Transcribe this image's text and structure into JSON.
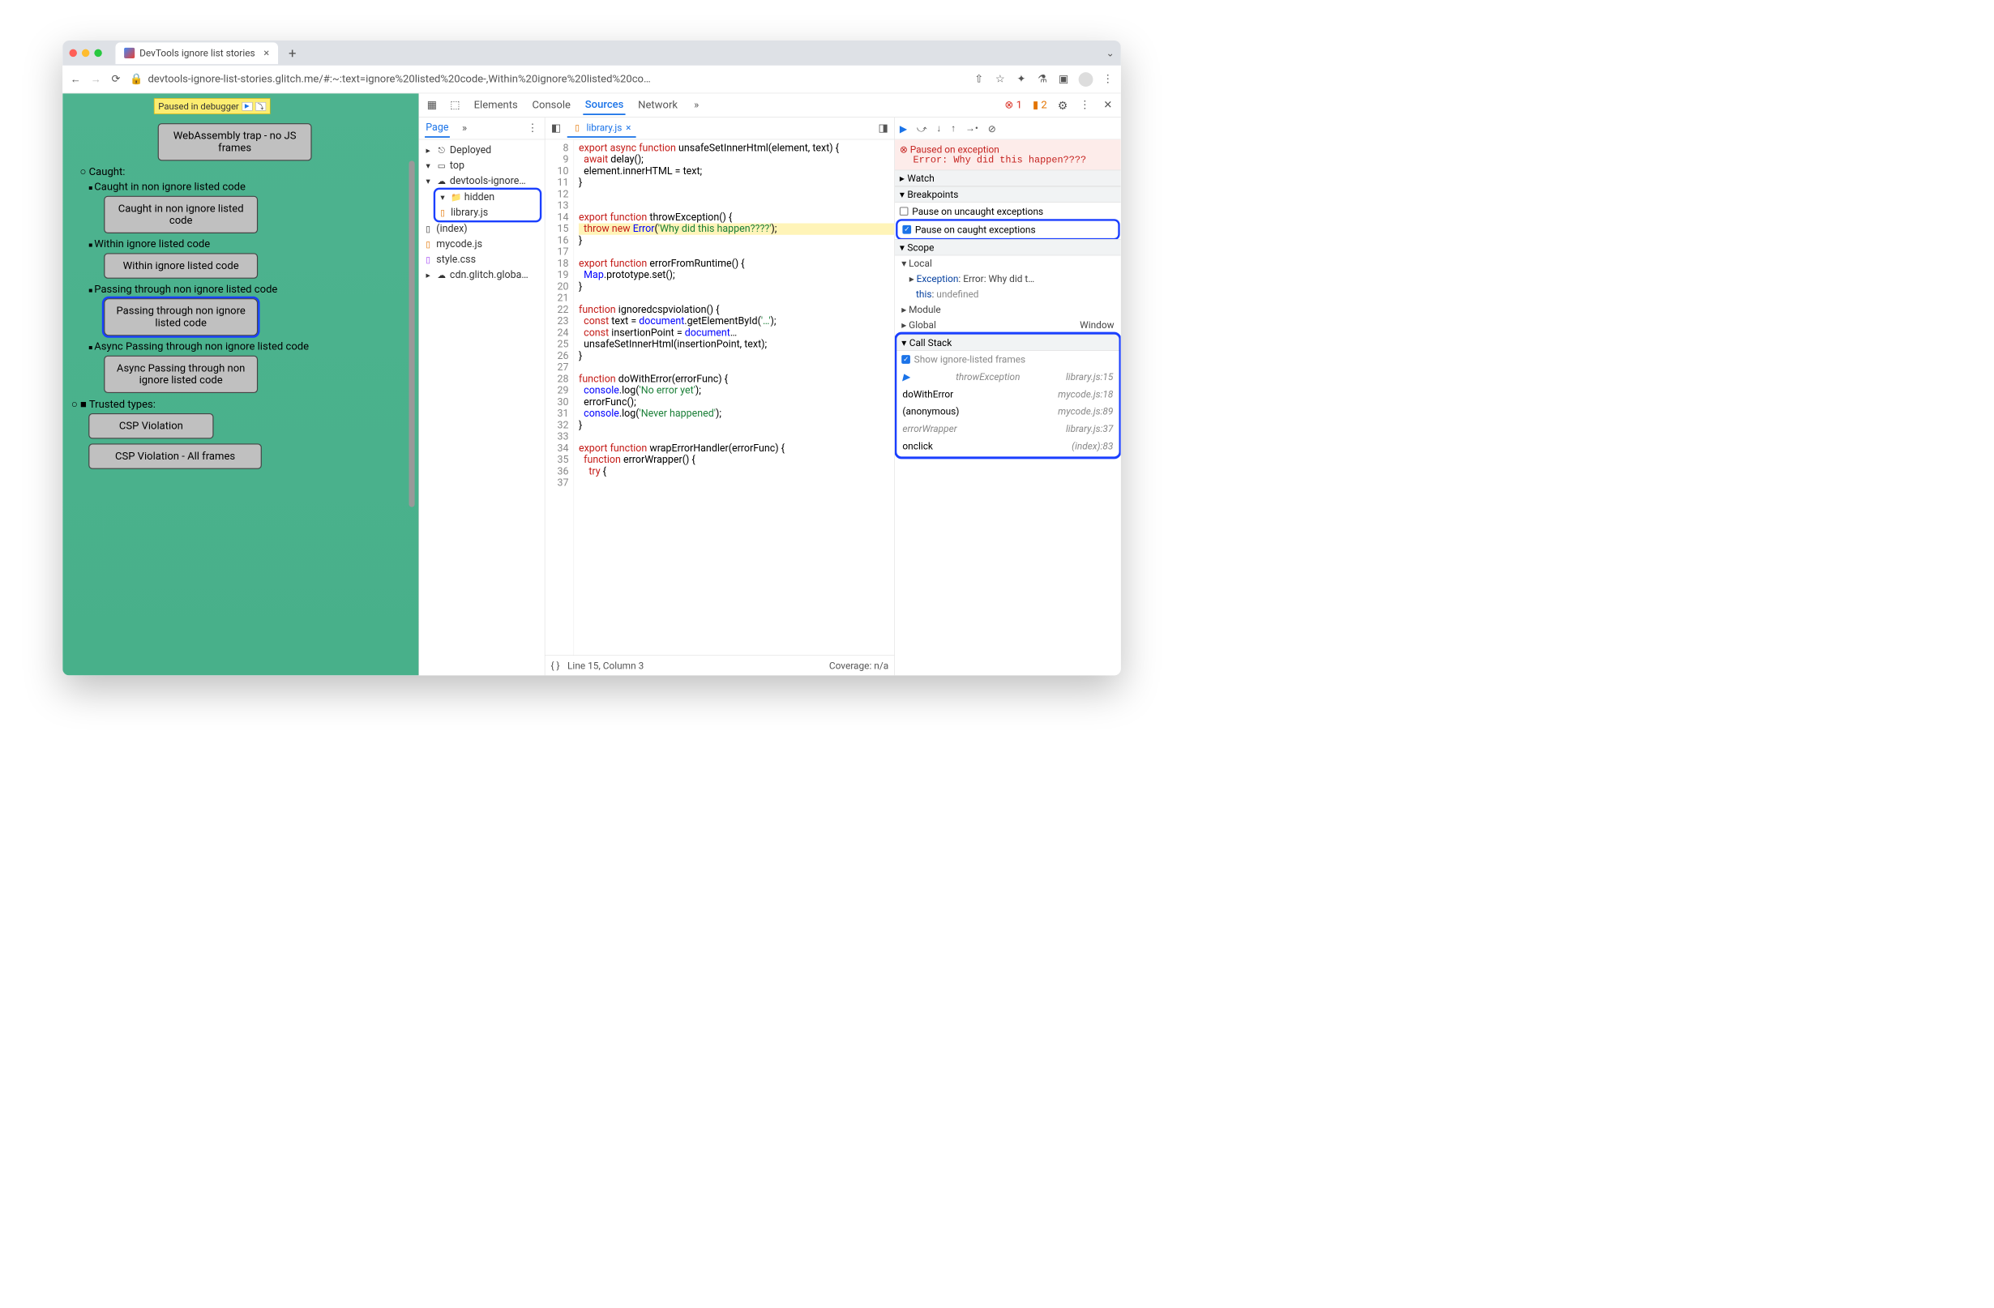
{
  "browser": {
    "tab_title": "DevTools ignore list stories",
    "url": "devtools-ignore-list-stories.glitch.me/#:~:text=ignore%20listed%20code-,Within%20ignore%20listed%20co…"
  },
  "paused_chip": "Paused in debugger",
  "story": {
    "btn_webasm": "WebAssembly trap - no JS frames",
    "caught": "Caught:",
    "caught_nonign": "Caught in non ignore listed code",
    "btn_caught_nonign": "Caught in non ignore listed code",
    "within_ign": "Within ignore listed code",
    "btn_within_ign": "Within ignore listed code",
    "passing": "Passing through non ignore listed code",
    "btn_passing": "Passing through non ignore listed code",
    "async_passing": "Async Passing through non ignore listed code",
    "btn_async_passing": "Async Passing through non ignore listed code",
    "trusted": "Trusted types:",
    "btn_csp": "CSP Violation",
    "btn_csp_all": "CSP Violation - All frames"
  },
  "devtools": {
    "tabs": {
      "elements": "Elements",
      "console": "Console",
      "sources": "Sources",
      "network": "Network"
    },
    "errors": "1",
    "warnings": "2"
  },
  "files": {
    "page": "Page",
    "deployed": "Deployed",
    "top": "top",
    "domain": "devtools-ignore…",
    "hidden": "hidden",
    "library": "library.js",
    "index": "(index)",
    "mycode": "mycode.js",
    "style": "style.css",
    "cdn": "cdn.glitch.globa…"
  },
  "editor": {
    "tab": "library.js",
    "status_line": "Line 15, Column 3",
    "coverage": "Coverage: n/a",
    "lines": {
      "8": "export async function unsafeSetInnerHtml(element, text) {",
      "9": "  await delay();",
      "10": "  element.innerHTML = text;",
      "11": "}",
      "12": "",
      "13": "",
      "14": "export function throwException() {",
      "15": "  throw new Error('Why did this happen????');",
      "16": "}",
      "17": "",
      "18": "export function errorFromRuntime() {",
      "19": "  Map.prototype.set();",
      "20": "}",
      "21": "",
      "22": "function ignoredcspviolation() {",
      "23": "  const text = document.getElementById('…');",
      "24": "  const insertionPoint = document…",
      "25": "  unsafeSetInnerHtml(insertionPoint, text);",
      "26": "}",
      "27": "",
      "28": "function doWithError(errorFunc) {",
      "29": "  console.log('No error yet');",
      "30": "  errorFunc();",
      "31": "  console.log('Never happened');",
      "32": "}",
      "33": "",
      "34": "export function wrapErrorHandler(errorFunc) {",
      "35": "  function errorWrapper() {",
      "36": "    try {"
    }
  },
  "dbg": {
    "paused_title": "Paused on exception",
    "paused_msg": "Error: Why did this happen????",
    "watch": "Watch",
    "breakpoints": "Breakpoints",
    "pause_uncaught": "Pause on uncaught exceptions",
    "pause_caught": "Pause on caught exceptions",
    "scope": "Scope",
    "local": "Local",
    "exception": "Exception: Error: Why did t…",
    "this": "this: undefined",
    "module": "Module",
    "global": "Global",
    "global_val": "Window",
    "call_stack": "Call Stack",
    "show_frames": "Show ignore-listed frames",
    "stack": [
      {
        "fn": "throwException",
        "loc": "library.js:15",
        "ign": true,
        "cur": true
      },
      {
        "fn": "doWithError",
        "loc": "mycode.js:18"
      },
      {
        "fn": "(anonymous)",
        "loc": "mycode.js:89"
      },
      {
        "fn": "errorWrapper",
        "loc": "library.js:37",
        "ign": true
      },
      {
        "fn": "onclick",
        "loc": "(index):83"
      }
    ]
  }
}
